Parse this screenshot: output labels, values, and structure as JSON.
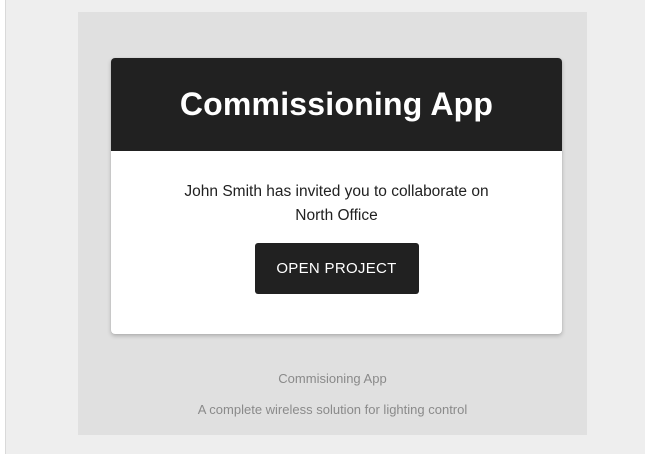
{
  "card": {
    "title": "Commissioning App",
    "invite_line_1": "John Smith has invited you to collaborate on",
    "invite_line_2": "North Office",
    "button_label": "OPEN PROJECT"
  },
  "footer": {
    "app_name": "Commisioning App",
    "tagline": "A complete wireless solution for lighting control"
  },
  "colors": {
    "header_bg": "#212121",
    "button_bg": "#212121",
    "page_bg": "#eeeeee",
    "email_bg": "#e0e0e0",
    "card_bg": "#ffffff",
    "footer_text": "#8a8a8a"
  }
}
